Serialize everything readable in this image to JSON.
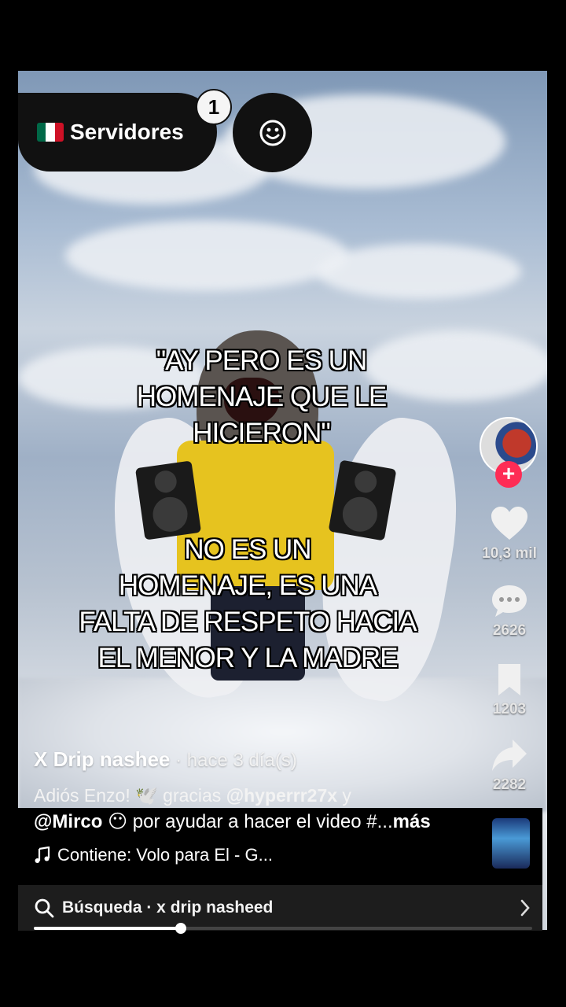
{
  "servers": {
    "flag_icon": "mexico-flag-icon",
    "label": "Servidores",
    "badge_count": "1"
  },
  "emoji_button": {
    "icon": "smiley-icon"
  },
  "captions": {
    "top": [
      "\"AY PERO ES UN",
      "HOMENAJE QUE LE",
      "HICIERON\""
    ],
    "bottom": [
      "NO ES UN",
      "HOMENAJE, ES UNA",
      "FALTA DE RESPETO HACIA",
      "EL MENOR Y LA MADRE"
    ]
  },
  "side_actions": {
    "likes": "10,3 mil",
    "comments": "2626",
    "saves": "1203",
    "shares": "2282"
  },
  "post": {
    "author": "X Drip nashee",
    "time": " · hace 3 día(s)",
    "desc_line1_text": "Adiós Enzo! 🕊️ gracias ",
    "desc_line1_mention": "@hyperrr27x",
    "desc_line1_tail": "  y",
    "desc_line2_mention": "@Mirco",
    "desc_line2_text": " 😶 por ayudar a hacer el video #...",
    "desc_more": "más",
    "music": "Contiene: Volo para El - G..."
  },
  "search": {
    "text": "Búsqueda · x drip nasheed"
  },
  "progress": {
    "fraction": 0.295
  },
  "colors": {
    "follow": "#fe2c55",
    "bar": "#1d1d1d"
  }
}
